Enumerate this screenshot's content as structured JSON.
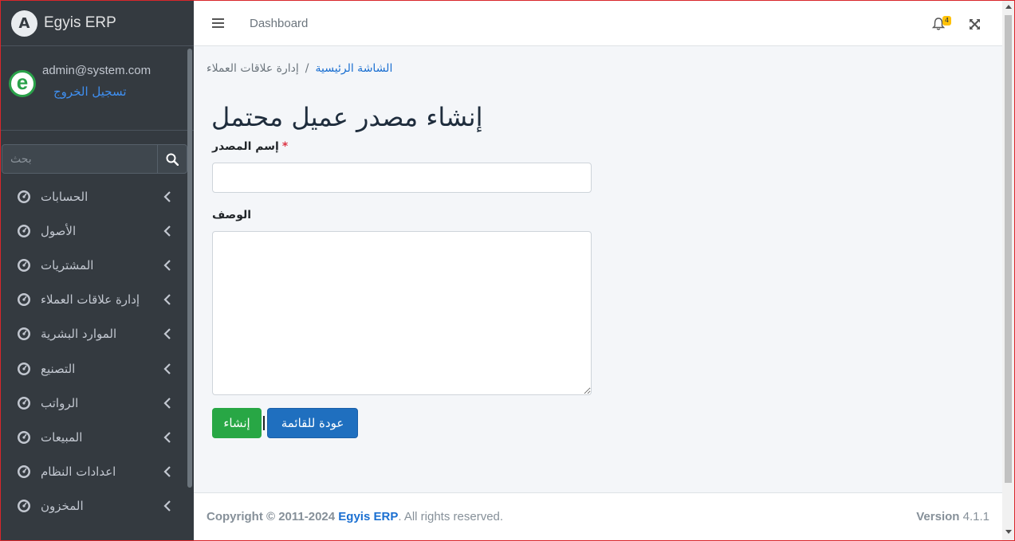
{
  "brand": {
    "name": "Egyis ERP",
    "logo_letter": "A"
  },
  "user": {
    "email": "admin@system.com",
    "logout_label": "تسجيل الخروج",
    "avatar_letter": "e"
  },
  "search": {
    "placeholder": "بحث"
  },
  "sidebar": {
    "items": [
      {
        "label": "الحسابات"
      },
      {
        "label": "الأصول"
      },
      {
        "label": "المشتريات"
      },
      {
        "label": "إدارة علاقات العملاء"
      },
      {
        "label": "الموارد البشرية"
      },
      {
        "label": "التصنيع"
      },
      {
        "label": "الرواتب"
      },
      {
        "label": "المبيعات"
      },
      {
        "label": "اعدادات النظام"
      },
      {
        "label": "المخزون"
      }
    ]
  },
  "topnav": {
    "dashboard_label": "Dashboard",
    "notification_count": "4"
  },
  "breadcrumb": {
    "home": "الشاشة الرئيسية",
    "separator": "/",
    "current": "إدارة علاقات العملاء"
  },
  "page": {
    "title": "إنشاء مصدر عميل محتمل"
  },
  "form": {
    "name_label": "إسم المصدر",
    "required_mark": "*",
    "name_value": "",
    "description_label": "الوصف",
    "description_value": "",
    "create_button": "إنشاء",
    "back_button": "عودة للقائمة"
  },
  "footer": {
    "copyright_prefix": "Copyright © 2011-2024",
    "brand": "Egyis ERP",
    "rights": ". All rights reserved.",
    "version_label": "Version",
    "version_value": "4.1.1"
  },
  "colors": {
    "sidebar_bg": "#343a40",
    "primary": "#1f6fbf",
    "success": "#28a745",
    "link": "#1a6fd1",
    "badge": "#ffc107"
  }
}
